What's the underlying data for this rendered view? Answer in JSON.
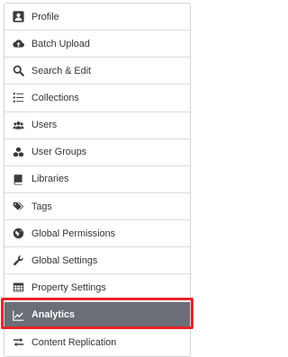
{
  "menu": {
    "items": [
      {
        "label": "Profile",
        "icon": "user-icon"
      },
      {
        "label": "Batch Upload",
        "icon": "cloud-upload-icon"
      },
      {
        "label": "Search & Edit",
        "icon": "search-icon"
      },
      {
        "label": "Collections",
        "icon": "list-icon"
      },
      {
        "label": "Users",
        "icon": "users-icon"
      },
      {
        "label": "User Groups",
        "icon": "cubes-icon"
      },
      {
        "label": "Libraries",
        "icon": "book-icon"
      },
      {
        "label": "Tags",
        "icon": "tags-icon"
      },
      {
        "label": "Global Permissions",
        "icon": "globe-icon"
      },
      {
        "label": "Global Settings",
        "icon": "wrench-icon"
      },
      {
        "label": "Property Settings",
        "icon": "table-icon"
      },
      {
        "label": "Analytics",
        "icon": "line-chart-icon",
        "active": true
      },
      {
        "label": "Content Replication",
        "icon": "exchange-icon"
      }
    ]
  },
  "colors": {
    "active_bg": "#6b6e76",
    "highlight_border": "#e8232a",
    "text": "#333333"
  }
}
